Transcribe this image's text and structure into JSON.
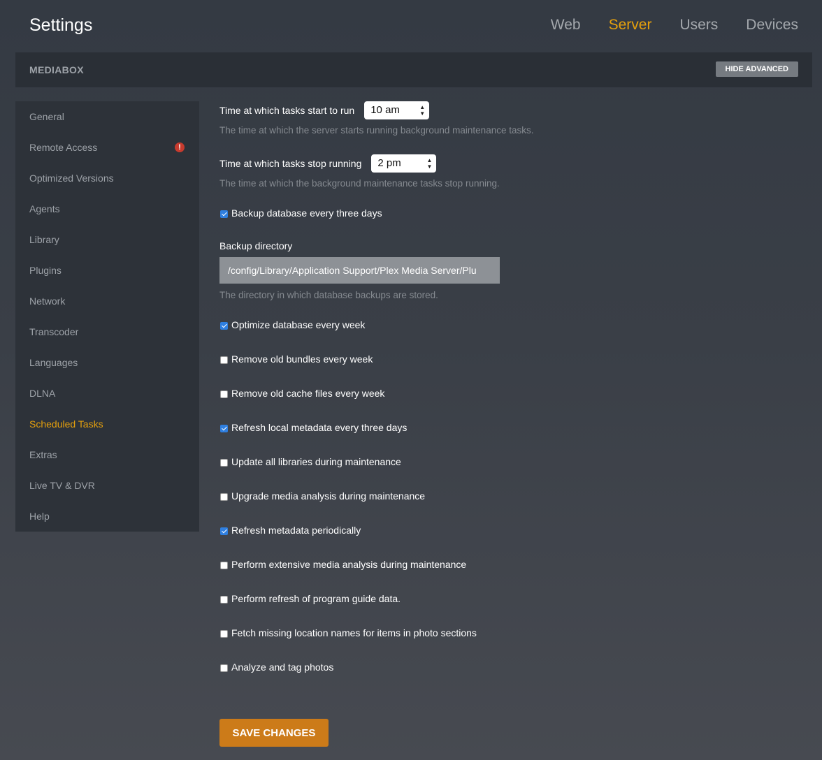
{
  "header": {
    "title": "Settings",
    "tabs": [
      {
        "label": "Web"
      },
      {
        "label": "Server"
      },
      {
        "label": "Users"
      },
      {
        "label": "Devices"
      }
    ]
  },
  "server_bar": {
    "name": "MEDIABOX",
    "hide_advanced_label": "HIDE ADVANCED"
  },
  "sidebar": {
    "items": [
      {
        "label": "General"
      },
      {
        "label": "Remote Access",
        "alert": "!"
      },
      {
        "label": "Optimized Versions"
      },
      {
        "label": "Agents"
      },
      {
        "label": "Library"
      },
      {
        "label": "Plugins"
      },
      {
        "label": "Network"
      },
      {
        "label": "Transcoder"
      },
      {
        "label": "Languages"
      },
      {
        "label": "DLNA"
      },
      {
        "label": "Scheduled Tasks"
      },
      {
        "label": "Extras"
      },
      {
        "label": "Live TV & DVR"
      },
      {
        "label": "Help"
      }
    ]
  },
  "settings": {
    "start_time": {
      "label": "Time at which tasks start to run",
      "value": "10 am",
      "help": "The time at which the server starts running background maintenance tasks."
    },
    "stop_time": {
      "label": "Time at which tasks stop running",
      "value": "2 pm",
      "help": "The time at which the background maintenance tasks stop running."
    },
    "backup_db": {
      "label": "Backup database every three days",
      "checked": true
    },
    "backup_dir": {
      "label": "Backup directory",
      "value": "/config/Library/Application Support/Plex Media Server/Plu",
      "help": "The directory in which database backups are stored."
    },
    "checkboxes": [
      {
        "label": "Optimize database every week",
        "checked": true
      },
      {
        "label": "Remove old bundles every week",
        "checked": false
      },
      {
        "label": "Remove old cache files every week",
        "checked": false
      },
      {
        "label": "Refresh local metadata every three days",
        "checked": true
      },
      {
        "label": "Update all libraries during maintenance",
        "checked": false
      },
      {
        "label": "Upgrade media analysis during maintenance",
        "checked": false
      },
      {
        "label": "Refresh metadata periodically",
        "checked": true
      },
      {
        "label": "Perform extensive media analysis during maintenance",
        "checked": false
      },
      {
        "label": "Perform refresh of program guide data.",
        "checked": false
      },
      {
        "label": "Fetch missing location names for items in photo sections",
        "checked": false
      },
      {
        "label": "Analyze and tag photos",
        "checked": false
      }
    ]
  },
  "save_label": "SAVE CHANGES",
  "colors": {
    "accent": "#e5a00d",
    "checkbox_checked": "#2f7fe0",
    "save_button": "#cc7b19",
    "alert": "#c73b2e"
  }
}
